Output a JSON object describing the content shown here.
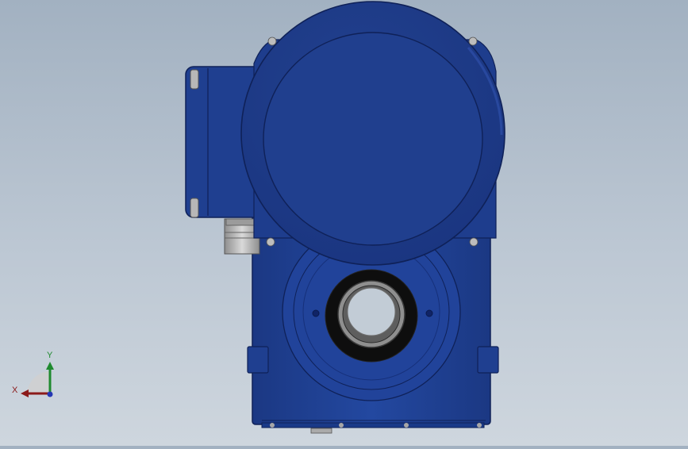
{
  "triad": {
    "x_label": "X",
    "y_label": "Y",
    "x_color": "#8b1a1a",
    "y_color": "#1f8a2f",
    "z_color": "#2436b4"
  },
  "colors": {
    "background_top": "#a2b1c1",
    "housing": "#1f3f90",
    "housing_dark": "#13286a",
    "housing_light": "#2b50ae",
    "bore_ring": "#111111",
    "bore_metal": "#9a9a9a",
    "fitting": "#b8b8b8"
  }
}
